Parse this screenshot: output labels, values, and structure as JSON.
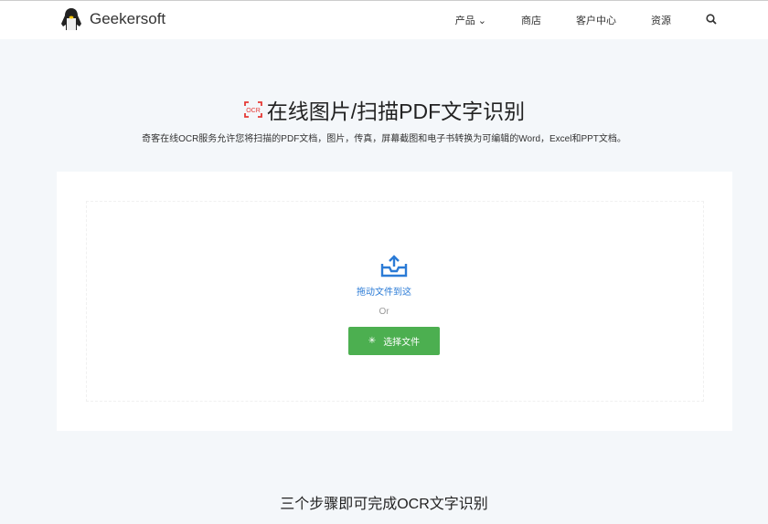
{
  "brand": "Geekersoft",
  "nav": {
    "items": [
      "产品",
      "商店",
      "客户中心",
      "资源"
    ]
  },
  "hero": {
    "title": "在线图片/扫描PDF文字识别",
    "icon_text": "OCR",
    "subtitle": "奇客在线OCR服务允许您将扫描的PDF文档，图片，传真，屏幕截图和电子书转换为可编辑的Word，Excel和PPT文档。"
  },
  "upload": {
    "drag_text": "拖动文件到这",
    "or_text": "Or",
    "button_label": "选择文件"
  },
  "section": {
    "title": "三个步骤即可完成OCR文字识别"
  },
  "colors": {
    "accent": "#4caf50",
    "link": "#2b7bd6",
    "ocr_icon": "#e53935"
  }
}
